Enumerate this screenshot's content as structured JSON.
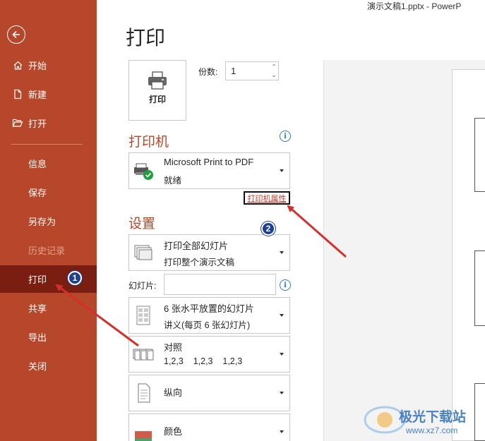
{
  "window": {
    "title": "演示文稿1.pptx  -  PowerP"
  },
  "sidebar": {
    "back_icon": "back-arrow-icon",
    "items": [
      {
        "label": "开始",
        "icon": "home-icon"
      },
      {
        "label": "新建",
        "icon": "new-file-icon"
      },
      {
        "label": "打开",
        "icon": "open-folder-icon"
      },
      {
        "label": "信息"
      },
      {
        "label": "保存"
      },
      {
        "label": "另存为"
      },
      {
        "label": "历史记录",
        "disabled": true
      },
      {
        "label": "打印",
        "active": true
      },
      {
        "label": "共享"
      },
      {
        "label": "导出"
      },
      {
        "label": "关闭"
      }
    ],
    "colors": {
      "background": "#b7472a",
      "active": "#7a1e12"
    }
  },
  "main": {
    "title": "打印",
    "print_button": {
      "label": "打印",
      "icon": "printer-icon"
    },
    "copies": {
      "label": "份数:",
      "value": "1"
    },
    "printer": {
      "heading": "打印机",
      "info_icon": "i",
      "name": "Microsoft Print to PDF",
      "status": "就绪",
      "properties_link": "打印机属性"
    },
    "settings": {
      "heading": "设置",
      "print_range": {
        "title": "打印全部幻灯片",
        "subtitle": "打印整个演示文稿"
      },
      "slides": {
        "label": "幻灯片:",
        "value": "",
        "info_icon": "i"
      },
      "layout": {
        "title": "6 张水平放置的幻灯片",
        "subtitle": "讲义(每页 6 张幻灯片)"
      },
      "collate": {
        "title": "对照",
        "subtitle": "1,2,3    1,2,3    1,2,3"
      },
      "orientation": {
        "title": "纵向"
      },
      "color": {
        "title": "颜色"
      }
    },
    "accent_color": "#b7472a"
  },
  "callouts": [
    {
      "number": "1"
    },
    {
      "number": "2"
    }
  ],
  "watermark": {
    "title": "极光下载站",
    "url": "www.xz7.com"
  }
}
